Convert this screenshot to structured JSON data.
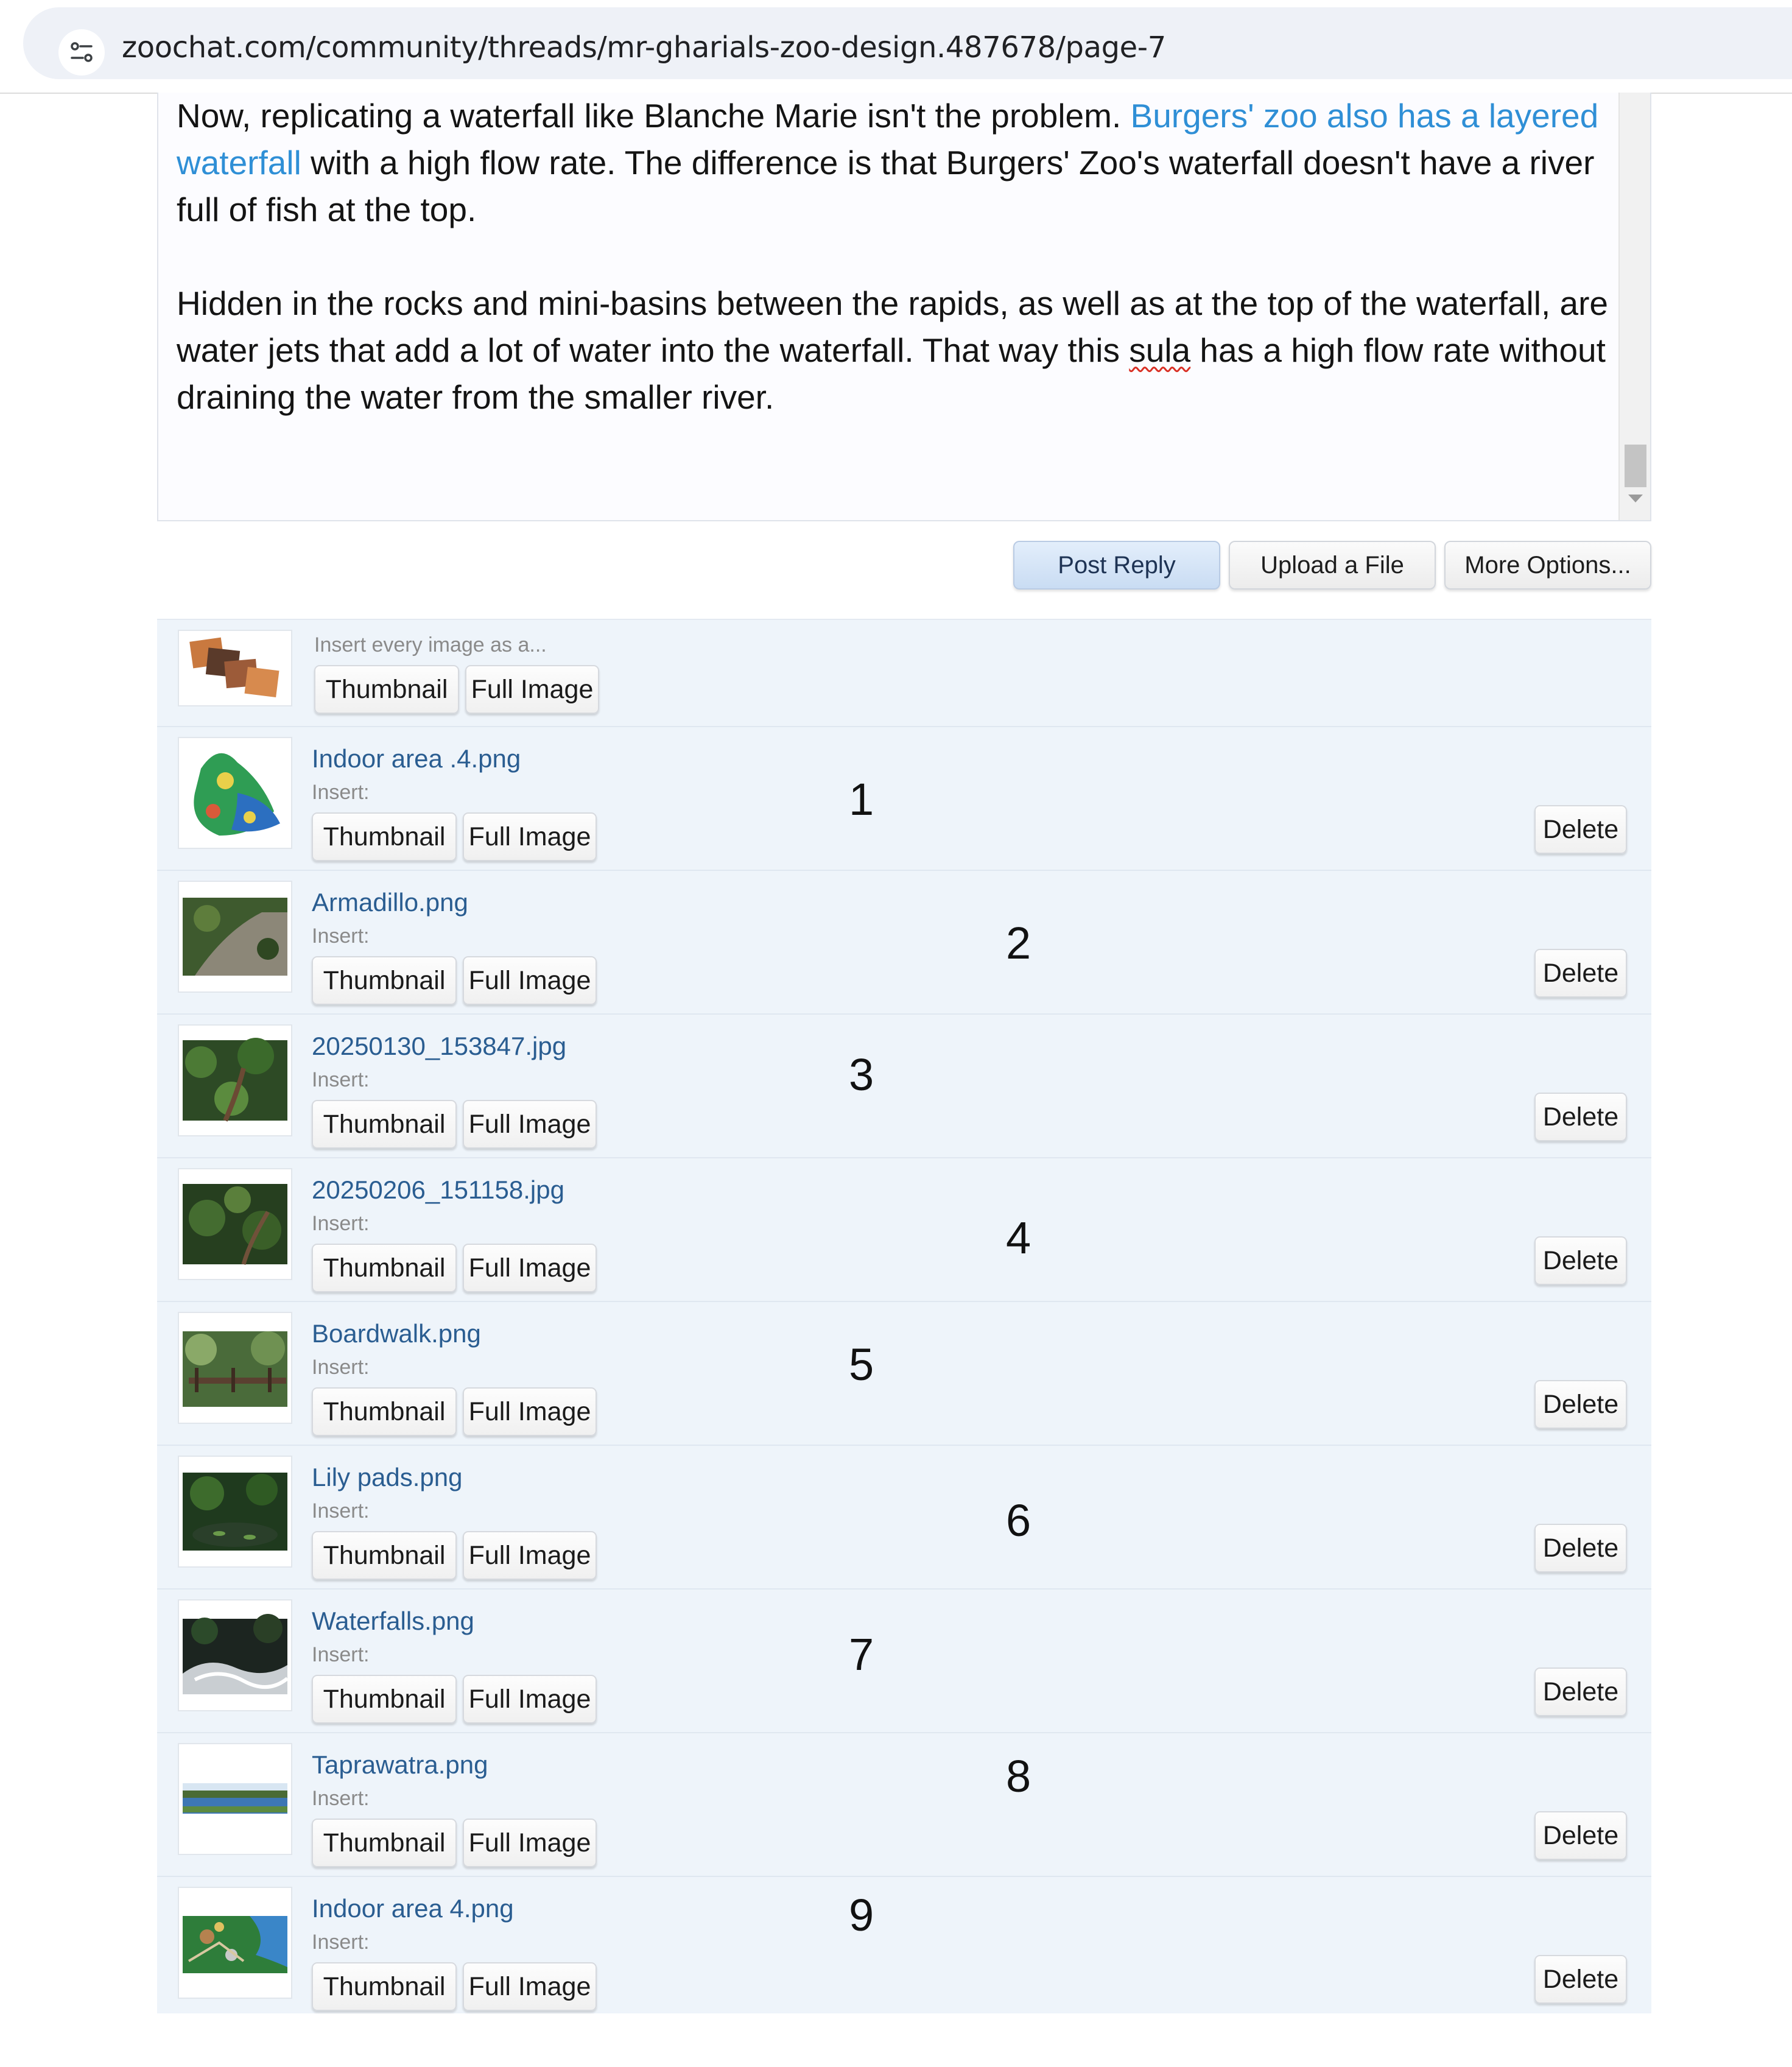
{
  "address_bar": {
    "url": "zoochat.com/community/threads/mr-gharials-zoo-design.487678/page-7"
  },
  "editor": {
    "paragraph1": {
      "before_link": "Now, replicating a waterfall like Blanche Marie isn't the problem. ",
      "link": "Burgers' zoo also has a layered waterfall",
      "after_link": " with a high flow rate. The difference is that Burgers' Zoo's waterfall doesn't have a river full of fish at the top."
    },
    "paragraph2": {
      "before_spell": "Hidden in the rocks and mini-basins between the rapids, as well as at the top of the waterfall, are water jets that add a lot of water into the waterfall. That way this ",
      "spell_word": "sula",
      "after_spell": " has a high flow rate without draining the water from the smaller river."
    }
  },
  "form_buttons": {
    "post_reply": "Post Reply",
    "upload": "Upload a File",
    "more_options": "More Options..."
  },
  "attachments": {
    "insert_all": {
      "label": "Insert every image as a...",
      "thumbnail": "Thumbnail",
      "full_image": "Full Image"
    },
    "insert_label": "Insert:",
    "thumbnail_label": "Thumbnail",
    "full_image_label": "Full Image",
    "delete_label": "Delete",
    "files": [
      {
        "name": "Indoor area .4.png",
        "number": "1",
        "thumb": "map-thumbnail"
      },
      {
        "name": "Armadillo.png",
        "number": "2",
        "thumb": "path-photo-thumbnail"
      },
      {
        "name": "20250130_153847.jpg",
        "number": "3",
        "thumb": "forest-photo-thumbnail"
      },
      {
        "name": "20250206_151158.jpg",
        "number": "4",
        "thumb": "forest-photo-thumbnail"
      },
      {
        "name": "Boardwalk.png",
        "number": "5",
        "thumb": "boardwalk-photo-thumbnail"
      },
      {
        "name": "Lily pads.png",
        "number": "6",
        "thumb": "pond-photo-thumbnail"
      },
      {
        "name": "Waterfalls.png",
        "number": "7",
        "thumb": "waterfall-photo-thumbnail"
      },
      {
        "name": "Taprawatra.png",
        "number": "8",
        "thumb": "lake-photo-thumbnail"
      },
      {
        "name": "Indoor area 4.png",
        "number": "9",
        "thumb": "indoor-map-thumbnail"
      }
    ]
  }
}
